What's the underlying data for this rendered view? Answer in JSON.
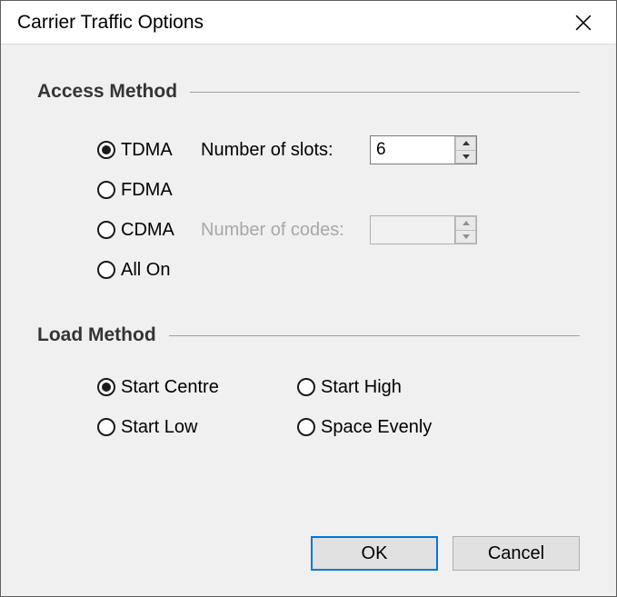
{
  "window": {
    "title": "Carrier Traffic Options"
  },
  "access": {
    "group_label": "Access Method",
    "options": {
      "tdma": "TDMA",
      "fdma": "FDMA",
      "cdma": "CDMA",
      "all_on": "All On"
    },
    "selected": "tdma",
    "slots_label": "Number of slots:",
    "slots_value": "6",
    "codes_label": "Number of codes:",
    "codes_value": ""
  },
  "load": {
    "group_label": "Load Method",
    "options": {
      "start_centre": "Start Centre",
      "start_high": "Start High",
      "start_low": "Start Low",
      "space_evenly": "Space Evenly"
    },
    "selected": "start_centre"
  },
  "buttons": {
    "ok": "OK",
    "cancel": "Cancel"
  }
}
